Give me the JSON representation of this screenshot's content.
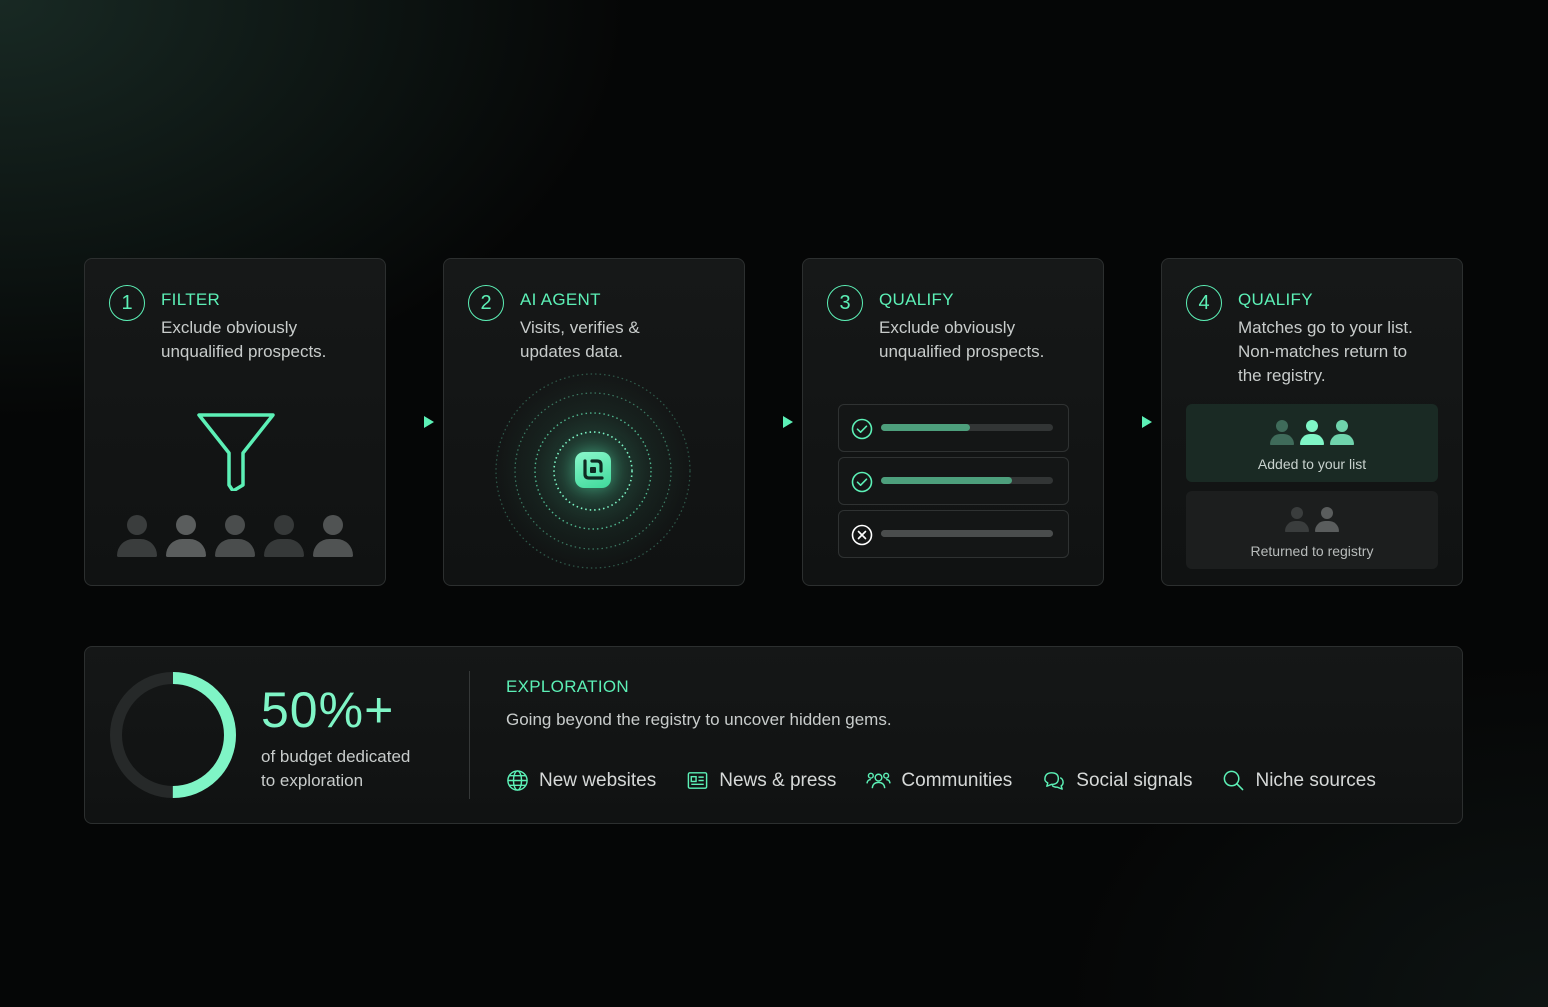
{
  "steps": [
    {
      "num": "1",
      "title": "FILTER",
      "desc": [
        "Exclude obviously",
        "unqualified prospects."
      ]
    },
    {
      "num": "2",
      "title": "AI AGENT",
      "desc": [
        "Visits, verifies &",
        "updates data."
      ]
    },
    {
      "num": "3",
      "title": "QUALIFY",
      "desc": [
        "Exclude obviously",
        "unqualified prospects."
      ]
    },
    {
      "num": "4",
      "title": "QUALIFY",
      "desc": [
        "Matches go to your list.",
        "Non-matches return to",
        "the registry."
      ]
    }
  ],
  "qualify_rows": [
    {
      "status": "pass",
      "progress": 0.52
    },
    {
      "status": "pass",
      "progress": 0.76
    },
    {
      "status": "fail",
      "progress": 1.0
    }
  ],
  "outcomes": {
    "added_label": "Added to your list",
    "returned_label": "Returned to registry"
  },
  "exploration": {
    "stat": "50%+",
    "stat_label": [
      "of budget dedicated",
      "to exploration"
    ],
    "budget_fraction": 0.5,
    "title": "EXPLORATION",
    "desc": "Going beyond the registry to uncover hidden gems.",
    "sources": [
      {
        "label": "New websites",
        "icon": "globe-icon"
      },
      {
        "label": "News & press",
        "icon": "newspaper-icon"
      },
      {
        "label": "Communities",
        "icon": "people-icon"
      },
      {
        "label": "Social signals",
        "icon": "chat-bubbles-icon"
      },
      {
        "label": "Niche sources",
        "icon": "search-icon"
      }
    ]
  },
  "colors": {
    "accent": "#5cf0b6",
    "accent_light": "#7ff5c6",
    "muted_person": "#3a3d3d",
    "fail_bar": "#4a4d4d",
    "pass_bar": "#4d9f7c"
  }
}
